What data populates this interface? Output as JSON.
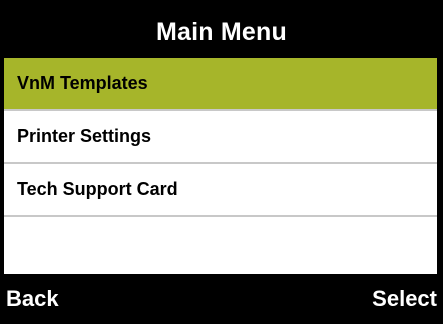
{
  "header": {
    "title": "Main Menu"
  },
  "menu": {
    "items": [
      {
        "label": "VnM Templates",
        "selected": true
      },
      {
        "label": "Printer Settings",
        "selected": false
      },
      {
        "label": "Tech Support Card",
        "selected": false
      }
    ]
  },
  "softkeys": {
    "left_label": "Back",
    "right_label": "Select"
  },
  "colors": {
    "background": "#000000",
    "panel": "#ffffff",
    "selection_highlight": "#a6b52a",
    "separator": "#c8c8c8",
    "text_on_dark": "#ffffff",
    "text_on_light": "#000000"
  }
}
